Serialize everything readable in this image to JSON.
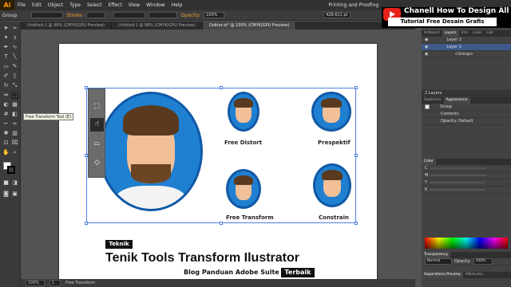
{
  "app_logo": "Ai",
  "menu": [
    "File",
    "Edit",
    "Object",
    "Type",
    "Select",
    "Effect",
    "View",
    "Window",
    "Help"
  ],
  "workspace": "Printing and Proofing",
  "control": {
    "group_label": "Group",
    "stroke_label": "Stroke:",
    "opacity_label": "Opacity:",
    "opacity_value": "100%",
    "width_value": "428.611 pt"
  },
  "doc_tabs": [
    {
      "label": "Untitled-2 @ 99% (CMYK/GPU Preview)",
      "active": false
    },
    {
      "label": "Untitled-1 @ 98% (CMYK/GPU Preview)",
      "active": false
    },
    {
      "label": "Doktor.ai* @ 100% (CMYK/GPU Preview)",
      "active": true
    }
  ],
  "tooltip": "Free Transform Tool (E)",
  "canvas": {
    "labels": {
      "free_distort": "Free Distort",
      "prespektif": "Prespektif",
      "free_transform": "Free Transform",
      "constrain": "Constrain"
    },
    "tag_teknik": "Teknik",
    "title": "Tenik Tools Transform Ilustrator",
    "blog_text": "Blog Panduan Adobe Suite",
    "tag_terbaik": "Terbaik"
  },
  "status": {
    "zoom": "100%",
    "page": "1",
    "tool": "Free Transform"
  },
  "youtube": {
    "channel": "Chanell How To Design All",
    "subtitle": "Tutorial Free Desain Grafis"
  },
  "layers_panel": {
    "tabs": [
      "Artboard",
      "Layers",
      "Info",
      "Links",
      "Libr"
    ],
    "active_tab": "Layers",
    "rows": [
      "Layer 2",
      "Layer 1",
      "<Group>"
    ],
    "footer": "2 Layers"
  },
  "appearance_panel": {
    "tabs": [
      "Swatches",
      "Appearance"
    ],
    "active_tab": "Appearance",
    "rows": [
      "Group",
      "Contents",
      "Opacity: Default"
    ]
  },
  "color_panel": {
    "title": "Color",
    "channels": [
      "C",
      "M",
      "Y",
      "K"
    ]
  },
  "transparency_panel": {
    "title": "Transparency",
    "mode": "Normal",
    "opacity_label": "Opacity:",
    "opacity_value": "100%"
  },
  "bottom_tabs": [
    "Separations Preview",
    "Attributes"
  ],
  "colors": {
    "accent": "#1f7fd0",
    "ring": "#1159a6",
    "selection": "#4f7de0",
    "app_bg": "#535353"
  }
}
